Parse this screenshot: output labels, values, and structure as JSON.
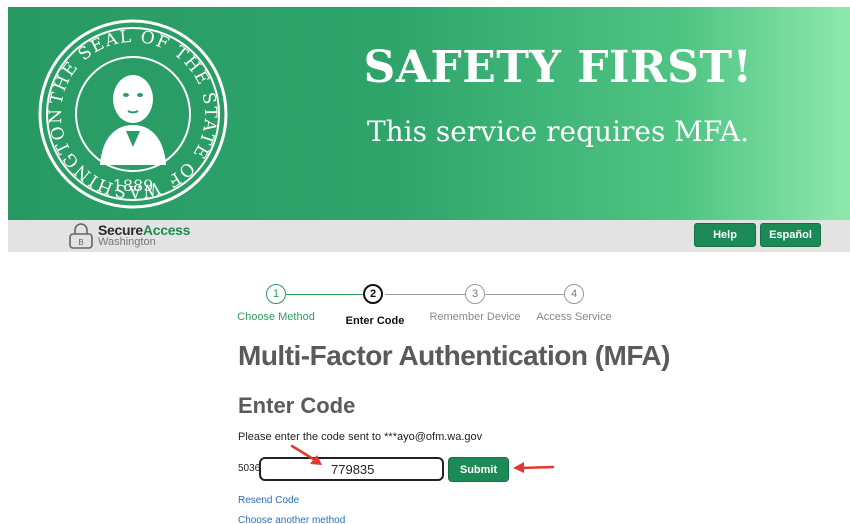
{
  "banner": {
    "title": "SAFETY FIRST!",
    "subtitle": "This service requires MFA.",
    "seal": {
      "text": "THE SEAL OF THE STATE OF WASHINGTON",
      "year": "1889"
    },
    "color": "#2ea46b"
  },
  "navbar": {
    "logo_main_a": "Secure",
    "logo_main_b": "Access",
    "logo_sub": "Washington",
    "help_label": "Help",
    "espanol_label": "Español",
    "button_color": "#1c8a57"
  },
  "stepper": {
    "steps": [
      {
        "number": "1",
        "label": "Choose Method",
        "state": "done"
      },
      {
        "number": "2",
        "label": "Enter Code",
        "state": "active"
      },
      {
        "number": "3",
        "label": "Remember Device",
        "state": "pending"
      },
      {
        "number": "4",
        "label": "Access Service",
        "state": "pending"
      }
    ]
  },
  "main": {
    "title": "Multi-Factor Authentication (MFA)",
    "subtitle": "Enter Code",
    "instruction": "Please enter the code sent to ***ayo@ofm.wa.gov",
    "code_prefix": "5036-",
    "code_value": "779835",
    "submit_label": "Submit",
    "resend_label": "Resend Code",
    "choose_label": "Choose another method"
  },
  "annotations": {
    "arrow_color": "#e03a2f"
  }
}
